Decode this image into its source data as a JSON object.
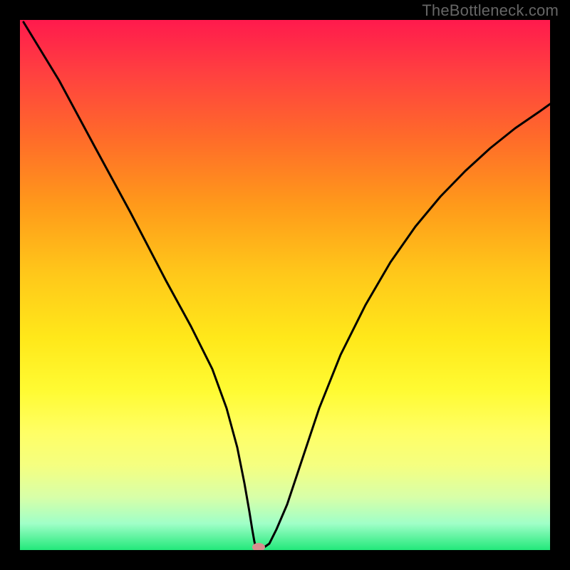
{
  "watermark": "TheBottleneck.com",
  "chart_data": {
    "type": "line",
    "title": "",
    "xlabel": "",
    "ylabel": "",
    "xlim": [
      0,
      1
    ],
    "ylim": [
      0,
      1
    ],
    "series": [
      {
        "name": "bottleneck-curve",
        "x": [
          0.0,
          0.05,
          0.1,
          0.15,
          0.2,
          0.25,
          0.3,
          0.35,
          0.38,
          0.4,
          0.42,
          0.44,
          0.46,
          0.5,
          0.55,
          0.6,
          0.65,
          0.7,
          0.75,
          0.8,
          0.85,
          0.9,
          0.95,
          1.0
        ],
        "y": [
          1.0,
          0.88,
          0.76,
          0.64,
          0.51,
          0.39,
          0.26,
          0.12,
          0.03,
          0.0,
          0.0,
          0.02,
          0.05,
          0.15,
          0.29,
          0.41,
          0.51,
          0.59,
          0.66,
          0.72,
          0.77,
          0.81,
          0.84,
          0.87
        ],
        "color": "#000000"
      }
    ],
    "markers": [
      {
        "name": "optimal-point",
        "x": 0.41,
        "y": 0.0,
        "color": "#d78f8f"
      }
    ],
    "background_gradient": {
      "top": "#ff1a4d",
      "bottom": "#22e87a"
    }
  }
}
